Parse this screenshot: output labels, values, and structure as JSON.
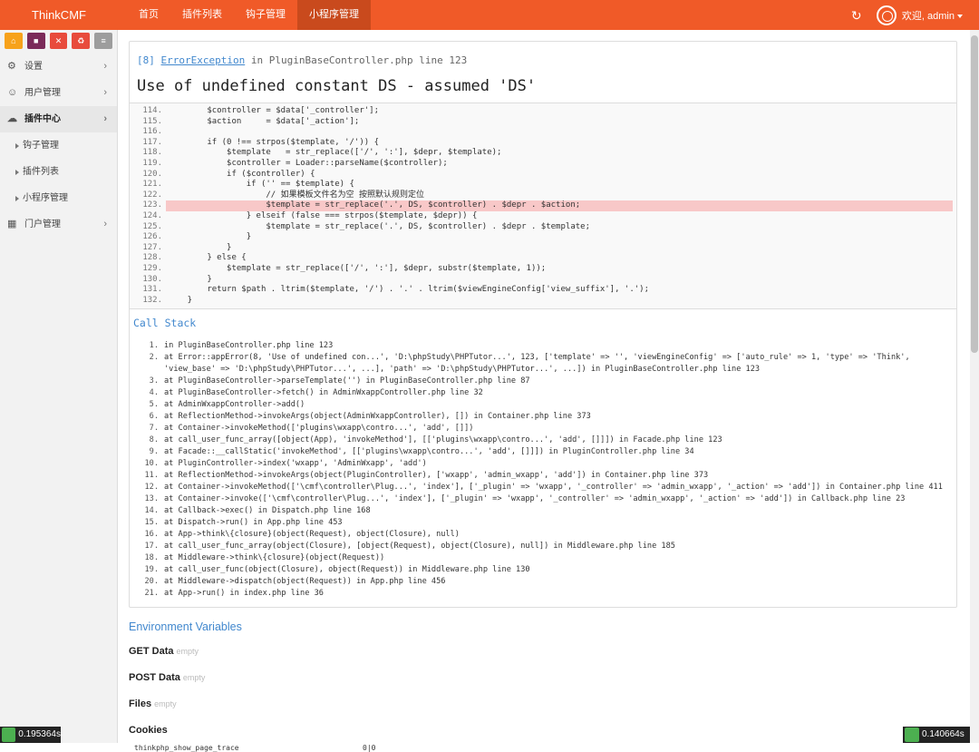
{
  "topbar": {
    "brand": "ThinkCMF",
    "nav": [
      "首页",
      "插件列表",
      "钩子管理",
      "小程序管理"
    ],
    "active_index": 3,
    "welcome": "欢迎, admin"
  },
  "sidebar": {
    "shortcuts": [
      {
        "icon": "home-icon",
        "color": "#f7a21b"
      },
      {
        "icon": "bookmark-icon",
        "color": "#7b2b5a"
      },
      {
        "icon": "trash-icon",
        "color": "#e84b3c"
      },
      {
        "icon": "recycle-icon",
        "color": "#e84b3c"
      },
      {
        "icon": "list-icon",
        "color": "#9d9d9d"
      }
    ],
    "menu": [
      {
        "label": "设置",
        "icon": "cogs-icon"
      },
      {
        "label": "用户管理",
        "icon": "users-icon"
      },
      {
        "label": "插件中心",
        "icon": "cloud-icon"
      },
      {
        "label": "钩子管理",
        "sub": true
      },
      {
        "label": "插件列表",
        "sub": true
      },
      {
        "label": "小程序管理",
        "sub": true
      },
      {
        "label": "门户管理",
        "icon": "grid-icon"
      }
    ]
  },
  "error": {
    "code": "[8]",
    "class": "ErrorException",
    "location": "in PluginBaseController.php line 123",
    "message": "Use of undefined constant DS - assumed 'DS'"
  },
  "code_lines": [
    {
      "n": "114.",
      "src": "        $controller = $data['_controller'];"
    },
    {
      "n": "115.",
      "src": "        $action     = $data['_action'];"
    },
    {
      "n": "116.",
      "src": ""
    },
    {
      "n": "117.",
      "src": "        if (0 !== strpos($template, '/')) {"
    },
    {
      "n": "118.",
      "src": "            $template   = str_replace(['/', ':'], $depr, $template);"
    },
    {
      "n": "119.",
      "src": "            $controller = Loader::parseName($controller);"
    },
    {
      "n": "120.",
      "src": "            if ($controller) {"
    },
    {
      "n": "121.",
      "src": "                if ('' == $template) {"
    },
    {
      "n": "122.",
      "src": "                    // 如果模板文件名为空 按照默认规则定位"
    },
    {
      "n": "123.",
      "src": "                    $template = str_replace('.', DS, $controller) . $depr . $action;",
      "hl": true
    },
    {
      "n": "124.",
      "src": "                } elseif (false === strpos($template, $depr)) {"
    },
    {
      "n": "125.",
      "src": "                    $template = str_replace('.', DS, $controller) . $depr . $template;"
    },
    {
      "n": "126.",
      "src": "                }"
    },
    {
      "n": "127.",
      "src": "            }"
    },
    {
      "n": "128.",
      "src": "        } else {"
    },
    {
      "n": "129.",
      "src": "            $template = str_replace(['/', ':'], $depr, substr($template, 1));"
    },
    {
      "n": "130.",
      "src": "        }"
    },
    {
      "n": "131.",
      "src": "        return $path . ltrim($template, '/') . '.' . ltrim($viewEngineConfig['view_suffix'], '.');"
    },
    {
      "n": "132.",
      "src": "    }"
    }
  ],
  "call_stack_title": "Call Stack",
  "call_stack": [
    "in PluginBaseController.php line 123",
    "at Error::appError(8, 'Use of undefined con...', 'D:\\phpStudy\\PHPTutor...', 123, ['template' => '', 'viewEngineConfig' => ['auto_rule' => 1, 'type' => 'Think', 'view_base' => 'D:\\phpStudy\\PHPTutor...', ...], 'path' => 'D:\\phpStudy\\PHPTutor...', ...]) in PluginBaseController.php line 123",
    "at PluginBaseController->parseTemplate('') in PluginBaseController.php line 87",
    "at PluginBaseController->fetch() in AdminWxappController.php line 32",
    "at AdminWxappController->add()",
    "at ReflectionMethod->invokeArgs(object(AdminWxappController), []) in Container.php line 373",
    "at Container->invokeMethod(['plugins\\wxapp\\contro...', 'add', []])",
    "at call_user_func_array([object(App), 'invokeMethod'], [['plugins\\wxapp\\contro...', 'add', []]]) in Facade.php line 123",
    "at Facade::__callStatic('invokeMethod', [['plugins\\wxapp\\contro...', 'add', []]]) in PluginController.php line 34",
    "at PluginController->index('wxapp', 'AdminWxapp', 'add')",
    "at ReflectionMethod->invokeArgs(object(PluginController), ['wxapp', 'admin_wxapp', 'add']) in Container.php line 373",
    "at Container->invokeMethod(['\\cmf\\controller\\Plug...', 'index'], ['_plugin' => 'wxapp', '_controller' => 'admin_wxapp', '_action' => 'add']) in Container.php line 411",
    "at Container->invoke(['\\cmf\\controller\\Plug...', 'index'], ['_plugin' => 'wxapp', '_controller' => 'admin_wxapp', '_action' => 'add']) in Callback.php line 23",
    "at Callback->exec() in Dispatch.php line 168",
    "at Dispatch->run() in App.php line 453",
    "at App->think\\{closure}(object(Request), object(Closure), null)",
    "at call_user_func_array(object(Closure), [object(Request), object(Closure), null]) in Middleware.php line 185",
    "at Middleware->think\\{closure}(object(Request))",
    "at call_user_func(object(Closure), object(Request)) in Middleware.php line 130",
    "at Middleware->dispatch(object(Request)) in App.php line 456",
    "at App->run() in index.php line 36"
  ],
  "env": {
    "title": "Environment Variables",
    "empty": "empty",
    "sections": [
      "GET Data",
      "POST Data",
      "Files",
      "Cookies"
    ],
    "cookie_key": "thinkphp_show_page_trace",
    "cookie_val": "0|0"
  },
  "timers": {
    "left": "0.195364s",
    "right": "0.140664s"
  }
}
